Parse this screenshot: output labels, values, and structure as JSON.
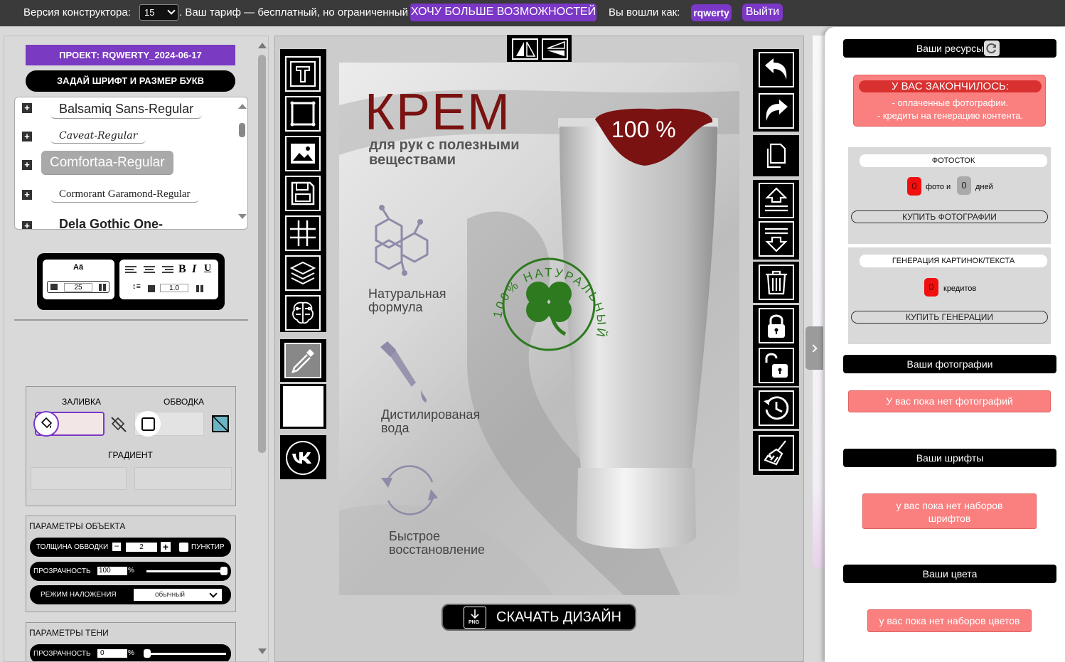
{
  "topbar": {
    "version_label": "Версия конструктора:",
    "version_value": "15",
    "tariff_text": ". Ваш тариф — бесплатный, но ограниченный",
    "upgrade_button": "ХОЧУ БОЛЬШЕ ВОЗМОЖНОСТЕЙ",
    "logged_in_label": "Вы вошли как:",
    "username": "rqwerty",
    "logout_button": "Выйти"
  },
  "left": {
    "project_label": "ПРОЕКТ:   RQWERTY_2024-06-17",
    "font_button": "ЗАДАЙ ШРИФТ И РАЗМЕР БУКВ",
    "fonts": [
      "Balsamiq Sans-Regular",
      "Caveat-Regular",
      "Comfortaa-Regular",
      "Cormorant Garamond-Regular",
      "Dela Gothic One-"
    ],
    "selected_font_index": 2,
    "font_size_icon": "Aä",
    "font_size_value": "25",
    "line_height_value": "1.0",
    "bold": "B",
    "italic": "I",
    "underline": "U",
    "fill_label": "ЗАЛИВКА",
    "stroke_label": "ОБВОДКА",
    "gradient_label": "ГРАДИЕНТ",
    "object_params_title": "ПАРАМЕТРЫ ОБЪЕКТА",
    "stroke_width_label": "ТОЛЩИНА ОБВОДКИ",
    "stroke_width_value": "2",
    "dashed_label": "ПУНКТИР",
    "opacity_label": "ПРОЗРАЧНОСТЬ",
    "opacity_value": "100",
    "percent": "%",
    "blend_label": "РЕЖИМ НАЛОЖЕНИЯ",
    "blend_value": "обычный",
    "shadow_title": "ПАРАМЕТРЫ ТЕНИ",
    "shadow_opacity_label": "ПРОЗРАЧНОСТЬ",
    "shadow_opacity_value": "0"
  },
  "poster": {
    "title": "КРЕМ",
    "subtitle_line1": "для рук с полезными",
    "subtitle_line2": "веществами",
    "badge": "100 %",
    "feature1_l1": "Натуральная",
    "feature1_l2": "формула",
    "feature2_l1": "Дистилированая",
    "feature2_l2": "вода",
    "feature3_l1": "Быстрое",
    "feature3_l2": "восстановление",
    "stamp_text": "100% НАТУРАЛЬНЫЙ ПРОДУКТ"
  },
  "download_button": "СКАЧАТЬ ДИЗАЙН",
  "download_icon_label": "PNG",
  "right": {
    "resources_title": "Ваши ресурсы",
    "out_title": "У ВАС ЗАКОНЧИЛОСЬ:",
    "out_line1": "- оплаченные фотографии.",
    "out_line2": "- кредиты на генерацию контента.",
    "photostock_title": "ФОТОСТОК",
    "photos_count": "0",
    "photos_label": "фото и",
    "days_count": "0",
    "days_label": "дней",
    "buy_photos": "КУПИТЬ ФОТОГРАФИИ",
    "generation_title": "ГЕНЕРАЦИЯ КАРТИНОК/ТЕКСТА",
    "credits_count": "0",
    "credits_label": "кредитов",
    "buy_generation": "КУПИТЬ ГЕНЕРАЦИИ",
    "photos_title": "Ваши фотографии",
    "no_photos": "У вас пока нет фотографий",
    "fonts_title": "Ваши шрифты",
    "no_fonts": "у вас пока нет наборов шрифтов",
    "colors_title": "Ваши цвета",
    "no_colors": "у вас пока нет наборов цветов"
  },
  "colors": {
    "accent": "#7b37c6",
    "brand_red": "#7a1212",
    "clover": "#2d7a1f",
    "warning": "#fa8080"
  }
}
